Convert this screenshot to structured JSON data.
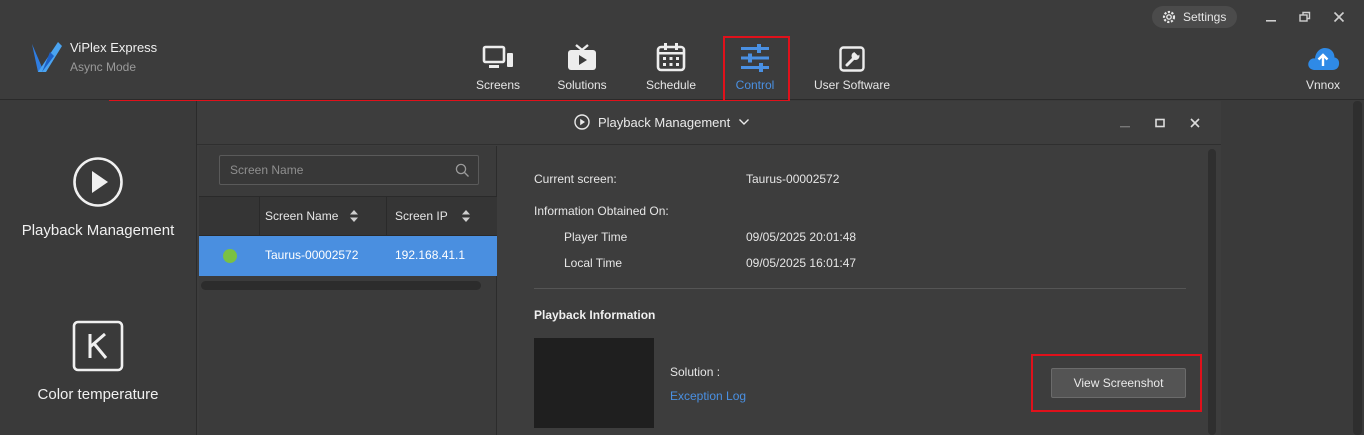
{
  "app": {
    "name": "ViPlex Express",
    "mode": "Async Mode"
  },
  "window": {
    "settings_label": "Settings",
    "cloud_label": "Vnnox"
  },
  "nav": {
    "items": [
      {
        "label": "Screens"
      },
      {
        "label": "Solutions"
      },
      {
        "label": "Schedule"
      },
      {
        "label": "Control"
      },
      {
        "label": "User Software"
      }
    ]
  },
  "sidebar": {
    "items": [
      {
        "label": "Playback Management",
        "icon": "play-circle-icon"
      },
      {
        "label": "Color temperature",
        "icon": "k-box-icon"
      }
    ]
  },
  "panel": {
    "title": "Playback Management",
    "search": {
      "placeholder": "Screen Name",
      "value": ""
    },
    "table": {
      "headers": [
        "Screen Name",
        "Screen IP"
      ],
      "rows": [
        {
          "name": "Taurus-00002572",
          "ip": "192.168.41.1",
          "status": "online"
        }
      ]
    },
    "detail": {
      "current_screen_label": "Current screen:",
      "current_screen_value": "Taurus-00002572",
      "info_obtained_label": "Information Obtained On:",
      "player_time_label": "Player Time",
      "player_time_value": "09/05/2025 20:01:48",
      "local_time_label": "Local Time",
      "local_time_value": "09/05/2025 16:01:47",
      "playback_info_title": "Playback Information",
      "solution_label": "Solution :",
      "exception_log_label": "Exception Log",
      "view_screenshot_label": "View Screenshot"
    }
  },
  "colors": {
    "accent": "#4a90e2",
    "highlight": "#e0111b",
    "online": "#7ac143",
    "selected_row": "#4a8fe0"
  }
}
